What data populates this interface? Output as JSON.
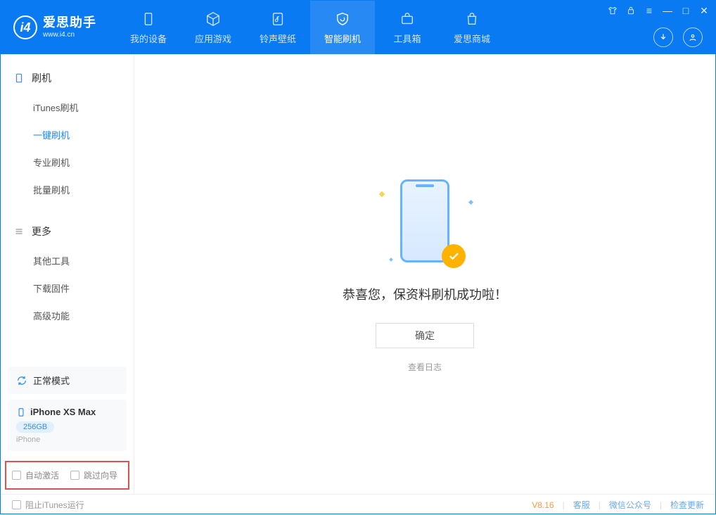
{
  "app": {
    "logo_title": "爱思助手",
    "logo_subtitle": "www.i4.cn"
  },
  "nav": {
    "my_device": "我的设备",
    "apps_games": "应用游戏",
    "ring_wall": "铃声壁纸",
    "smart_flash": "智能刷机",
    "toolbox": "工具箱",
    "store": "爱思商城"
  },
  "sidebar": {
    "flash_header": "刷机",
    "items": {
      "itunes": "iTunes刷机",
      "onekey": "一键刷机",
      "pro": "专业刷机",
      "batch": "批量刷机"
    },
    "more_header": "更多",
    "more": {
      "other_tools": "其他工具",
      "download_fw": "下载固件",
      "advanced": "高级功能"
    },
    "mode_label": "正常模式",
    "device": {
      "name": "iPhone XS Max",
      "capacity": "256GB",
      "type": "iPhone"
    },
    "options": {
      "auto_activate": "自动激活",
      "skip_guide": "跳过向导"
    }
  },
  "main": {
    "success_title": "恭喜您，保资料刷机成功啦！",
    "ok_button": "确定",
    "view_log": "查看日志"
  },
  "footer": {
    "block_itunes": "阻止iTunes运行",
    "version": "V8.16",
    "support": "客服",
    "wechat": "微信公众号",
    "update": "检查更新"
  }
}
